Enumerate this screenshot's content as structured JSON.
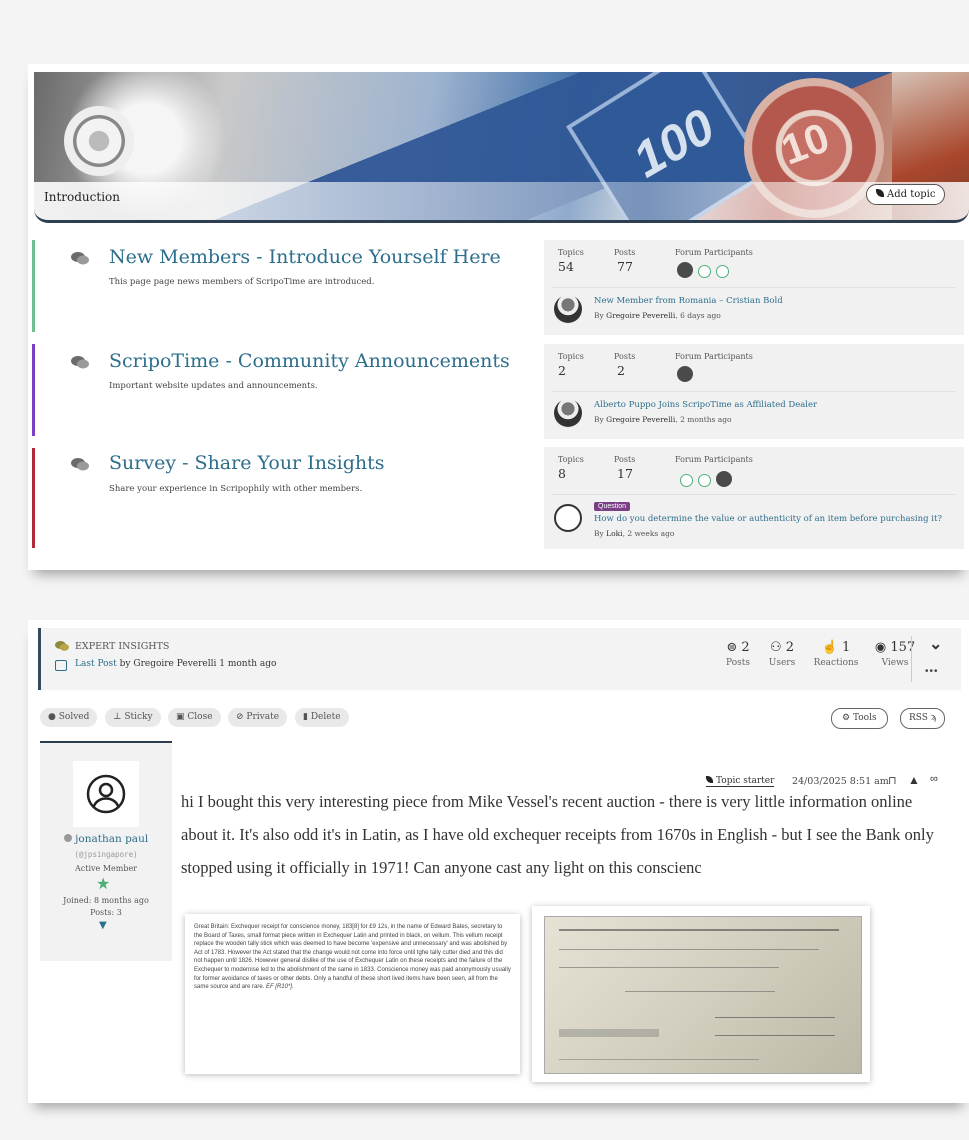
{
  "forum": {
    "category_title": "Introduction",
    "add_topic_label": "Add topic",
    "rows": [
      {
        "title": "New Members - Introduce Yourself Here",
        "description": "This page page news members of ScripoTime are introduced.",
        "accent": "#6fbf8e",
        "topics_label": "Topics",
        "topics": "54",
        "posts_label": "Posts",
        "posts": "77",
        "participants_label": "Forum Participants",
        "last_title": "New Member from Romania – Cristian Bold",
        "last_by_prefix": "By ",
        "last_author": "Gregoire Peverelli",
        "last_time": ", 6 days ago"
      },
      {
        "title": "ScripoTime - Community Announcements",
        "description": "Important website updates and announcements.",
        "accent": "#7b3fbf",
        "topics_label": "Topics",
        "topics": "2",
        "posts_label": "Posts",
        "posts": "2",
        "participants_label": "Forum Participants",
        "last_title": "Alberto Puppo Joins ScripoTime as Affiliated Dealer",
        "last_by_prefix": "By ",
        "last_author": "Gregoire Peverelli",
        "last_time": ", 2 months ago"
      },
      {
        "title": "Survey - Share Your Insights",
        "description": "Share your experience in Scripophily with other members.",
        "accent": "#b02a3a",
        "topics_label": "Topics",
        "topics": "8",
        "posts_label": "Posts",
        "posts": "17",
        "participants_label": "Forum Participants",
        "badge": "Question",
        "last_title": "How do you determine the value or authenticity of an item before purchasing it?",
        "last_by_prefix": "By ",
        "last_author": "Loki",
        "last_time": ", 2 weeks ago"
      }
    ]
  },
  "topic": {
    "section": "EXPERT INSIGHTS",
    "last_post_label": "Last Post",
    "last_post_by": " by ",
    "last_post_author": "Gregoire Peverelli",
    "last_post_time": " 1 month ago",
    "stats": [
      {
        "value": "2",
        "label": "Posts",
        "icon": "posts-icon"
      },
      {
        "value": "2",
        "label": "Users",
        "icon": "users-icon"
      },
      {
        "value": "1",
        "label": "Reactions",
        "icon": "thumbs-up-icon"
      },
      {
        "value": "157",
        "label": "Views",
        "icon": "eye-icon"
      }
    ],
    "more": "•••",
    "actions": [
      "Solved",
      "Sticky",
      "Close",
      "Private",
      "Delete"
    ],
    "tools_label": "Tools",
    "rss_label": "RSS",
    "author": {
      "name": "jonathan paul",
      "handle": "(@jpsingapore)",
      "role": "Active Member",
      "joined": "Joined: 8 months ago",
      "posts": "Posts: 3"
    },
    "starter_label": "Topic starter",
    "date": "24/03/2025 8:51 am",
    "body": "hi I bought this very interesting piece from Mike Vessel's recent auction - there is very little information online about it. It's also odd it's in Latin, as I have old exchequer receipts from 1670s in English - but I see the Bank only stopped using it officially in 1971!  Can anyone cast any light on this conscienc",
    "attachment_text_a": "Great Britain: Exchequer receipt for conscience money, 183[8] for £9 12s, in the name of Edward Bates, secretary to the Board of Taxes, small format piece written in Exchequer Latin and printed in black, on vellum. This vellum receipt replace the wooden tally stick which was deemed to have become 'expensive and unnecessary' and was abolished by Act of 1783. However the Act stated that the change would not come into force until tghe tally cutter died and this did not happen until 1826. However general dislike of the use of Exchequer Latin on these receipts and the failure of the Exchequer to modernise led to the abolishment of the same in 1833. Conscience money was paid anonymously usually for former avoidance of taxes or other debts. Only a handful of these short lived items have been seen, all from the same source and are rare. ",
    "attachment_text_b": "EF [R10*]."
  }
}
